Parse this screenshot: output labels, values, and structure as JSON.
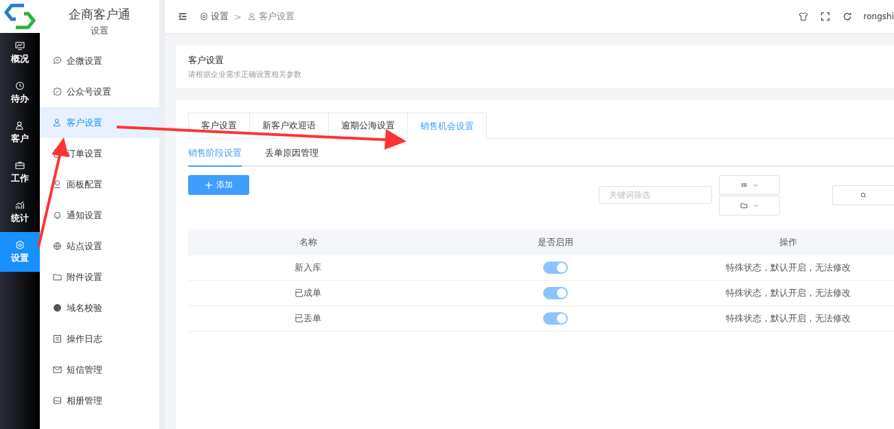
{
  "app": {
    "title": "企商客户通",
    "section": "设置"
  },
  "rail": [
    {
      "label": "概况",
      "selected": false
    },
    {
      "label": "待办",
      "selected": false
    },
    {
      "label": "客户",
      "selected": false
    },
    {
      "label": "工作",
      "selected": false
    },
    {
      "label": "统计",
      "selected": false
    },
    {
      "label": "设置",
      "selected": true
    }
  ],
  "menu": [
    {
      "label": "企微设置",
      "selected": false
    },
    {
      "label": "公众号设置",
      "selected": false
    },
    {
      "label": "客户设置",
      "selected": true
    },
    {
      "label": "订单设置",
      "selected": false
    },
    {
      "label": "面板配置",
      "selected": false
    },
    {
      "label": "通知设置",
      "selected": false
    },
    {
      "label": "站点设置",
      "selected": false
    },
    {
      "label": "附件设置",
      "selected": false
    },
    {
      "label": "域名校验",
      "selected": false
    },
    {
      "label": "操作日志",
      "selected": false
    },
    {
      "label": "短信管理",
      "selected": false
    },
    {
      "label": "相册管理",
      "selected": false
    }
  ],
  "breadcrumb": [
    "设置",
    "客户设置"
  ],
  "breadcrumb_separator": ">",
  "user": "rongshi",
  "page_header": {
    "title": "客户设置",
    "subtitle": "请根据企业需求正确设置相关参数"
  },
  "tabs": [
    {
      "label": "客户设置",
      "selected": false
    },
    {
      "label": "新客户欢迎语",
      "selected": false
    },
    {
      "label": "逾期公海设置",
      "selected": false
    },
    {
      "label": "销售机会设置",
      "selected": true
    }
  ],
  "subtabs": [
    {
      "label": "销售阶段设置",
      "selected": true
    },
    {
      "label": "丢单原因管理",
      "selected": false
    }
  ],
  "add_button": {
    "icon": "+",
    "label": "添加"
  },
  "filter": {
    "placeholder": "关键词筛选"
  },
  "table": {
    "columns": [
      "名称",
      "是否启用",
      "操作"
    ],
    "rows": [
      {
        "name": "新入库",
        "on": true,
        "disabled": true,
        "action": "特殊状态，默认开启，无法修改"
      },
      {
        "name": "已成单",
        "on": true,
        "disabled": true,
        "action": "特殊状态，默认开启，无法修改"
      },
      {
        "name": "已丢单",
        "on": true,
        "disabled": true,
        "action": "特殊状态，默认开启，无法修改"
      }
    ]
  }
}
